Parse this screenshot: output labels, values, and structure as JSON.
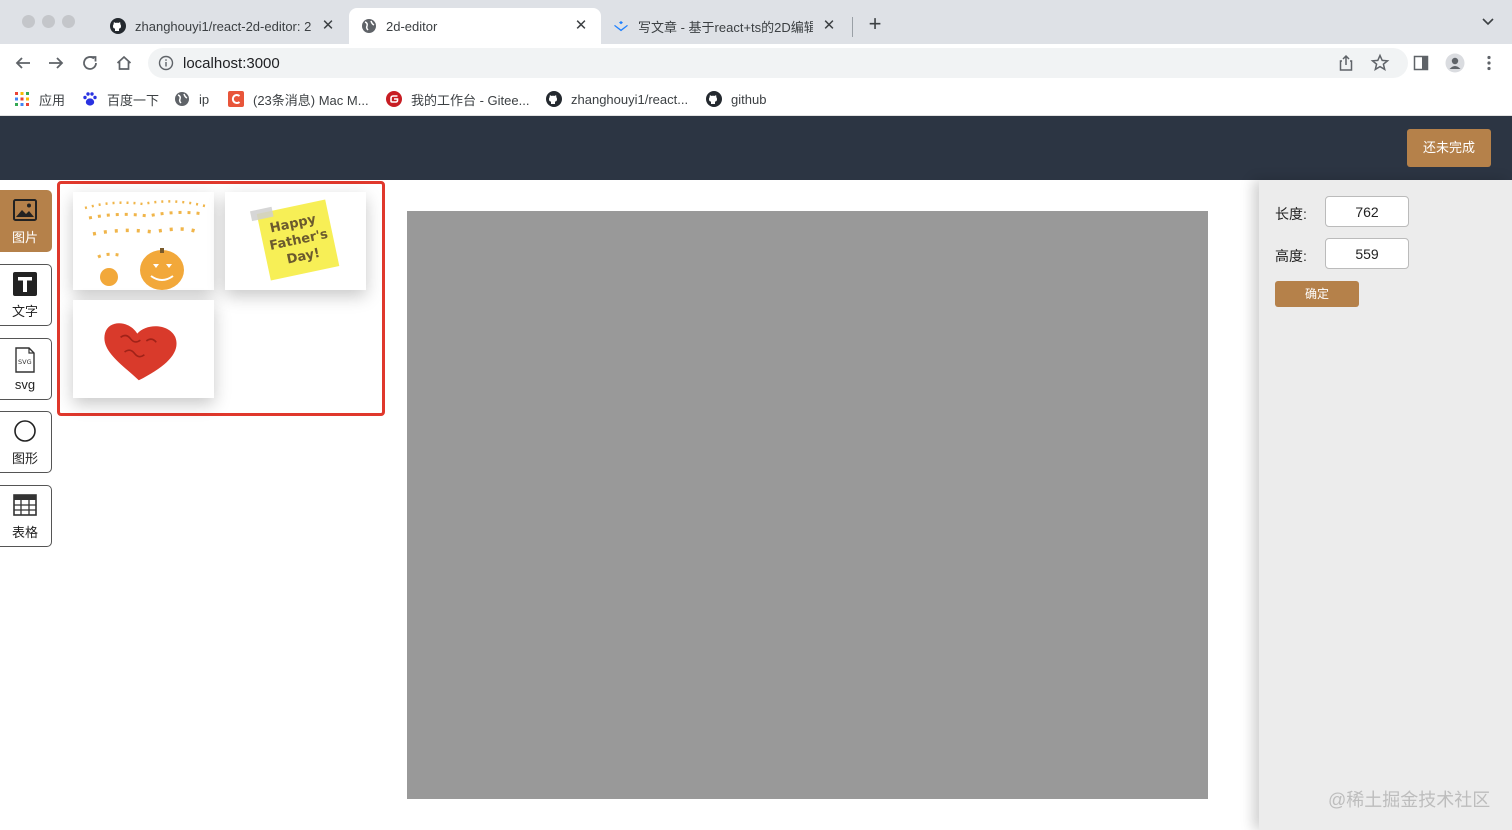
{
  "browser": {
    "tabs": [
      {
        "title": "zhanghouyi1/react-2d-editor: 2",
        "active": false
      },
      {
        "title": "2d-editor",
        "active": true
      },
      {
        "title": "写文章 - 基于react+ts的2D编辑",
        "active": false
      }
    ],
    "url": "localhost:3000",
    "bookmarks": [
      {
        "label": "应用",
        "icon": "apps-grid-icon"
      },
      {
        "label": "百度一下",
        "icon": "baidu-paw-icon"
      },
      {
        "label": "ip",
        "icon": "globe-icon"
      },
      {
        "label": "(23条消息) Mac M...",
        "icon": "csdn-c-icon"
      },
      {
        "label": "我的工作台 - Gitee...",
        "icon": "gitee-icon"
      },
      {
        "label": "zhanghouyi1/react...",
        "icon": "github-icon"
      },
      {
        "label": "github",
        "icon": "github-icon"
      }
    ]
  },
  "header": {
    "unfinished_label": "还未完成"
  },
  "sidebar": {
    "items": [
      {
        "label": "图片",
        "icon": "image-icon",
        "active": true
      },
      {
        "label": "文字",
        "icon": "text-icon",
        "active": false
      },
      {
        "label": "svg",
        "icon": "svg-file-icon",
        "active": false
      },
      {
        "label": "图形",
        "icon": "circle-icon",
        "active": false
      },
      {
        "label": "表格",
        "icon": "table-icon",
        "active": false
      }
    ]
  },
  "image_panel": {
    "images": [
      {
        "name": "halloween-pumpkins"
      },
      {
        "name": "fathers-day-note",
        "note_lines": [
          "Happy",
          "Father's",
          "Day!"
        ]
      },
      {
        "name": "red-heart"
      }
    ]
  },
  "properties": {
    "width_label": "长度:",
    "width_value": "762",
    "height_label": "高度:",
    "height_value": "559",
    "confirm_label": "确定"
  },
  "watermark": "@稀土掘金技术社区",
  "colors": {
    "header": "#2c3543",
    "accent": "#b5814a",
    "canvas": "#999999",
    "highlight": "#e0382c"
  }
}
